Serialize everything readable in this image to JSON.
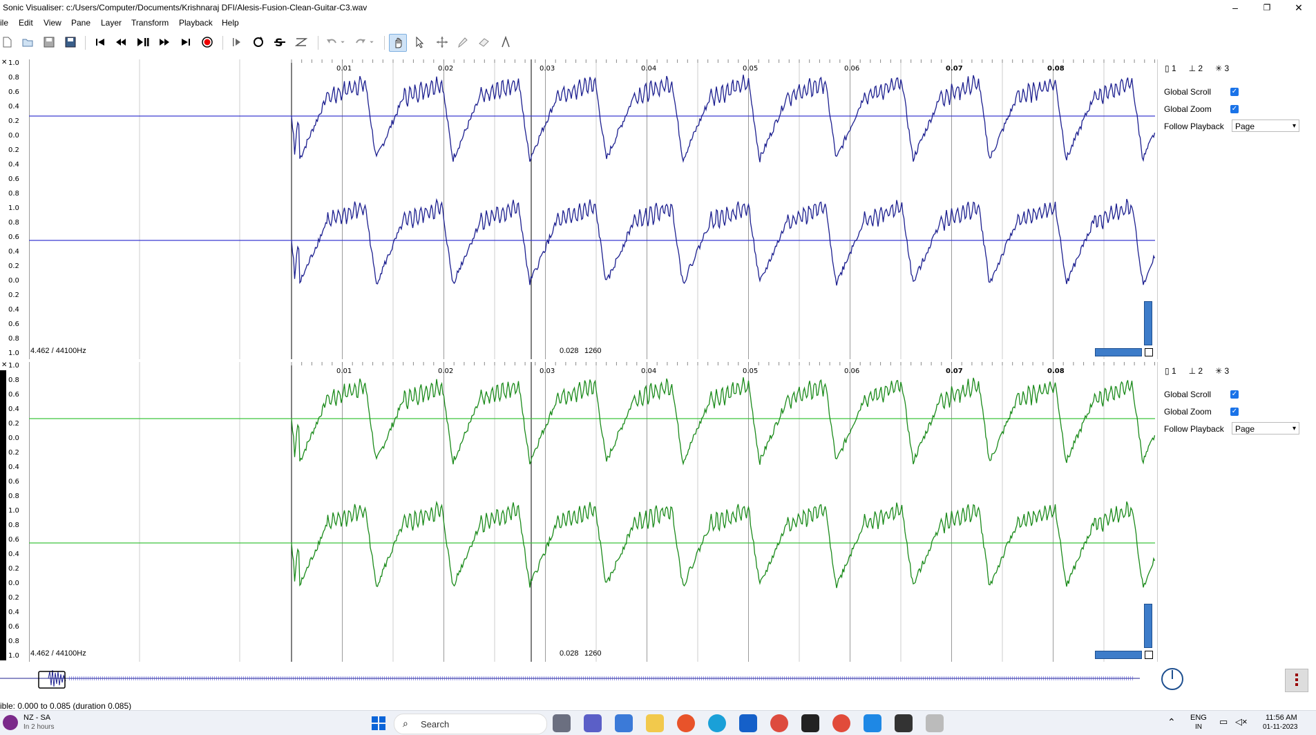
{
  "window": {
    "title": "Sonic Visualiser: c:/Users/Computer/Documents/Krishnaraj DFI/Alesis-Fusion-Clean-Guitar-C3.wav",
    "minimize": "–",
    "maximize": "❐",
    "close": "✕"
  },
  "menu": [
    "ile",
    "Edit",
    "View",
    "Pane",
    "Layer",
    "Transform",
    "Playback",
    "Help"
  ],
  "toolbar": {
    "icons": [
      "new-file-icon",
      "open-folder-icon",
      "save-icon",
      "save-as-icon",
      "rewind-start-icon",
      "rewind-icon",
      "play-pause-icon",
      "fast-forward-icon",
      "fast-forward-end-icon",
      "record-icon",
      "play-selection-icon",
      "loop-icon",
      "solo-icon",
      "speed-icon",
      "undo-icon",
      "redo-icon",
      "navigate-hand-icon",
      "select-arrow-icon",
      "move-icon",
      "draw-pencil-icon",
      "erase-icon",
      "measure-icon"
    ]
  },
  "panes": [
    {
      "scale_labels": [
        "1.0",
        "0.8",
        "0.6",
        "0.4",
        "0.2",
        "0.0",
        "0.2",
        "0.4",
        "0.6",
        "0.8",
        "1.0",
        "0.8",
        "0.6",
        "0.4",
        "0.2",
        "0.0",
        "0.2",
        "0.4",
        "0.6",
        "0.8",
        "1.0"
      ],
      "time_labels": [
        "0.01",
        "0.02",
        "0.03",
        "0.04",
        "0.05",
        "0.06",
        "0.07",
        "0.08"
      ],
      "corner_left": "4.462 / 44100Hz",
      "cursor_time": "0.028",
      "cursor_frame": "1260",
      "waveform_color": "#1c1f8f",
      "baseline_color": "#3a3ad0",
      "tabs": [
        "1",
        "2",
        "3"
      ],
      "global_scroll": "Global Scroll",
      "global_zoom": "Global Zoom",
      "follow_playback": "Follow Playback",
      "follow_value": "Page"
    },
    {
      "scale_labels": [
        "1.0",
        "0.8",
        "0.6",
        "0.4",
        "0.2",
        "0.0",
        "0.2",
        "0.4",
        "0.6",
        "0.8",
        "1.0",
        "0.8",
        "0.6",
        "0.4",
        "0.2",
        "0.0",
        "0.2",
        "0.4",
        "0.6",
        "0.8",
        "1.0"
      ],
      "time_labels": [
        "0.01",
        "0.02",
        "0.03",
        "0.04",
        "0.05",
        "0.06",
        "0.07",
        "0.08"
      ],
      "corner_left": "4.462 / 44100Hz",
      "cursor_time": "0.028",
      "cursor_frame": "1260",
      "waveform_color": "#1a8a1a",
      "baseline_color": "#3cc43c",
      "tabs": [
        "1",
        "2",
        "3"
      ],
      "global_scroll": "Global Scroll",
      "global_zoom": "Global Zoom",
      "follow_playback": "Follow Playback",
      "follow_value": "Page"
    }
  ],
  "status": "ible: 0.000 to 0.085 (duration 0.085)",
  "taskbar": {
    "weather": "NZ - SA",
    "weather_sub": "In 2 hours",
    "search": "Search",
    "lang": "ENG",
    "lang_sub": "IN",
    "time": "11:56 AM",
    "date": "01-11-2023"
  }
}
